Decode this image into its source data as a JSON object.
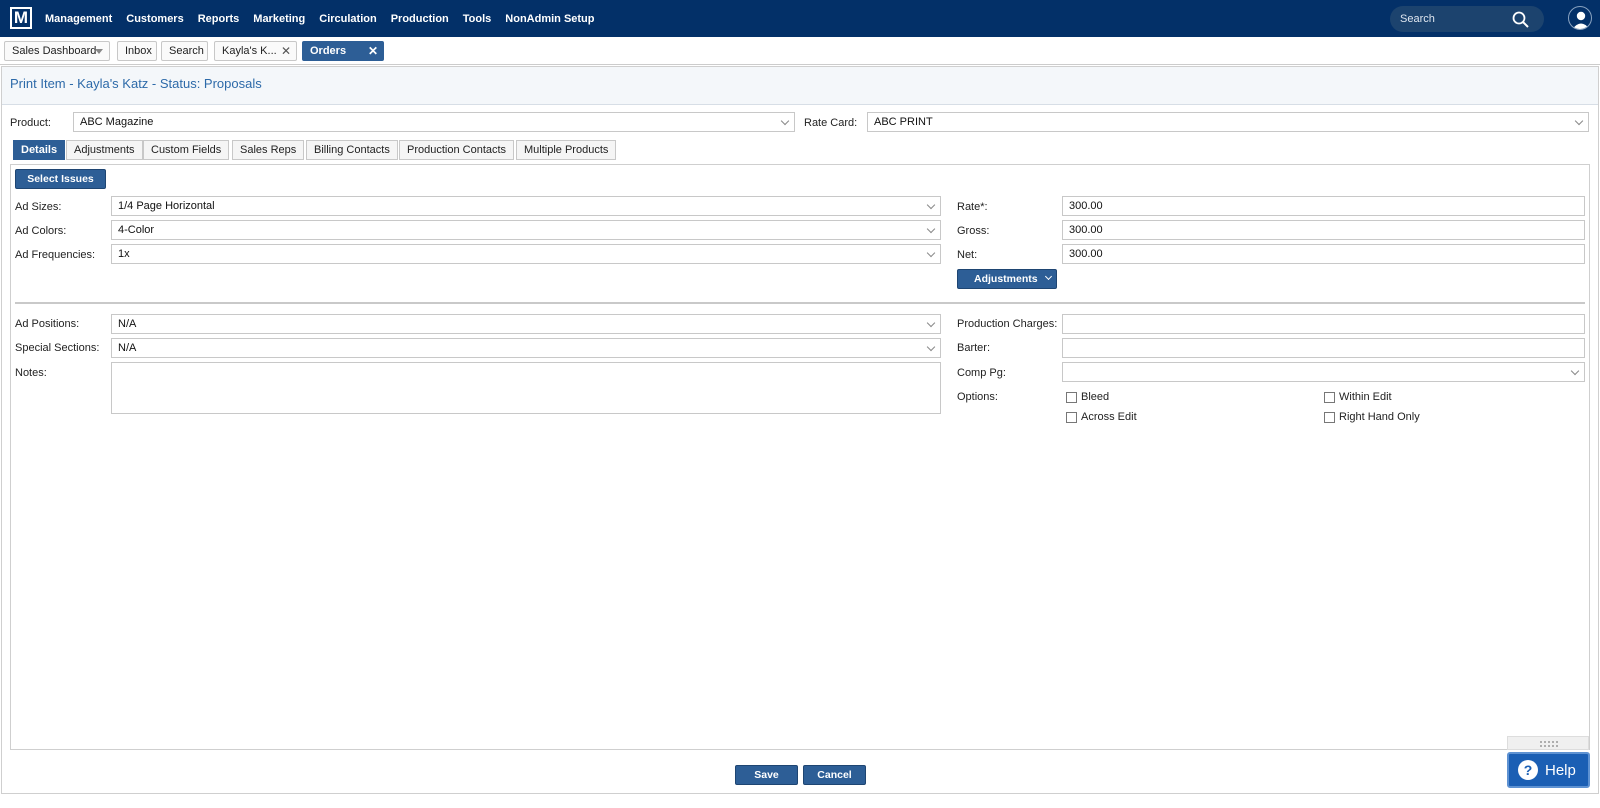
{
  "nav": {
    "logo": "M",
    "menu": [
      "Management",
      "Customers",
      "Reports",
      "Marketing",
      "Circulation",
      "Production",
      "Tools",
      "NonAdmin Setup"
    ],
    "search_placeholder": "Search"
  },
  "tabs": [
    {
      "label": "Sales Dashboard"
    },
    {
      "label": "Inbox"
    },
    {
      "label": "Search"
    },
    {
      "label": "Kayla's K..."
    },
    {
      "label": "Orders"
    }
  ],
  "page": {
    "title": "Print Item - Kayla's Katz - Status: Proposals",
    "product_label": "Product:",
    "product_value": "ABC Magazine",
    "rate_card_label": "Rate Card:",
    "rate_card_value": "ABC PRINT"
  },
  "subtabs": [
    "Details",
    "Adjustments",
    "Custom Fields",
    "Sales Reps",
    "Billing Contacts",
    "Production Contacts",
    "Multiple Products"
  ],
  "details": {
    "select_issues": "Select Issues",
    "ad_sizes_label": "Ad Sizes:",
    "ad_sizes_value": "1/4 Page Horizontal",
    "ad_colors_label": "Ad Colors:",
    "ad_colors_value": "4-Color",
    "ad_freq_label": "Ad Frequencies:",
    "ad_freq_value": "1x",
    "rate_label": "Rate*:",
    "rate_value": "300.00",
    "gross_label": "Gross:",
    "gross_value": "300.00",
    "net_label": "Net:",
    "net_value": "300.00",
    "adjustments_btn": "Adjustments",
    "ad_positions_label": "Ad Positions:",
    "ad_positions_value": "N/A",
    "special_sections_label": "Special Sections:",
    "special_sections_value": "N/A",
    "notes_label": "Notes:",
    "production_charges_label": "Production Charges:",
    "production_charges_value": "",
    "barter_label": "Barter:",
    "barter_value": "",
    "comp_pg_label": "Comp Pg:",
    "comp_pg_value": "",
    "options_label": "Options:",
    "options": [
      "Bleed",
      "Within Edit",
      "Across Edit",
      "Right Hand Only"
    ]
  },
  "footer": {
    "save": "Save",
    "cancel": "Cancel"
  },
  "help": {
    "label": "Help"
  },
  "colors": {
    "nav_bg": "#033068",
    "accent": "#2d5e96",
    "title": "#2d6aa9"
  }
}
